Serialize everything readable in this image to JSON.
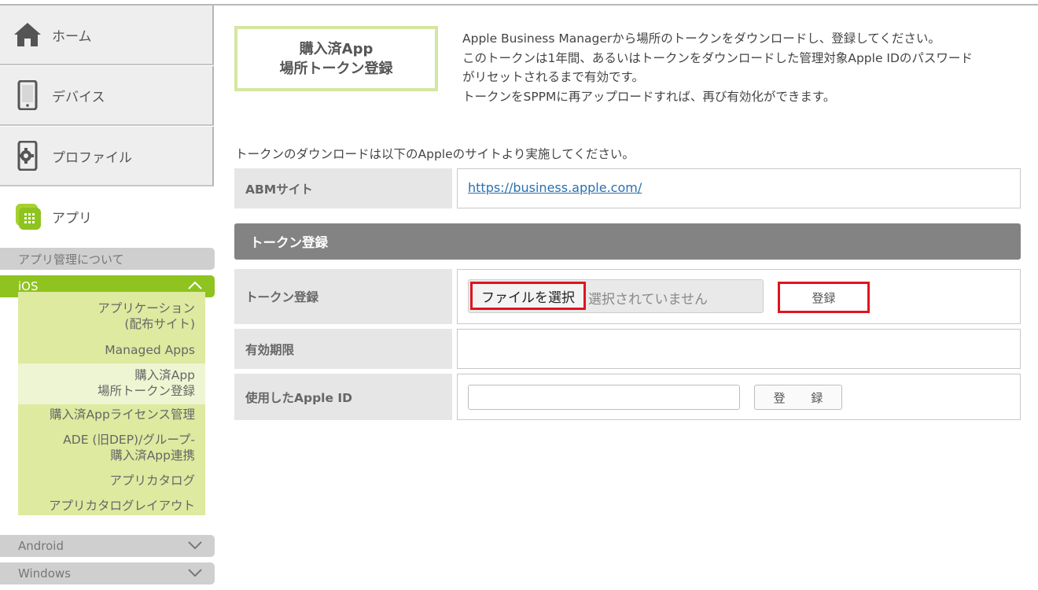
{
  "sidebar": {
    "home": "ホーム",
    "devices": "デバイス",
    "profiles": "プロファイル",
    "apps": "アプリ",
    "about_apps": "アプリ管理について",
    "ios": "iOS",
    "ios_items": [
      {
        "line1": "アプリケーション",
        "line2": "(配布サイト)"
      },
      {
        "line1": "Managed Apps",
        "line2": ""
      },
      {
        "line1": "購入済App",
        "line2": "場所トークン登録"
      },
      {
        "line1": "購入済Appライセンス管理",
        "line2": ""
      },
      {
        "line1": "ADE (旧DEP)/グループ-",
        "line2": "購入済App連携"
      },
      {
        "line1": "アプリカタログ",
        "line2": ""
      },
      {
        "line1": "アプリカタログレイアウト",
        "line2": ""
      }
    ],
    "android": "Android",
    "windows": "Windows"
  },
  "header": {
    "title_line1": "購入済App",
    "title_line2": "場所トークン登録",
    "desc_lines": [
      "Apple Business Managerから場所のトークンをダウンロードし、登録してください。",
      "このトークンは1年間、あるいはトークンをダウンロードした管理対象Apple IDのパスワード",
      "がリセットされるまで有効です。",
      "トークンをSPPMに再アップロードすれば、再び有効化ができます。"
    ]
  },
  "download_note": "トークンのダウンロードは以下のAppleのサイトより実施してください。",
  "abm": {
    "label": "ABMサイト",
    "url": "https://business.apple.com/"
  },
  "token_section": {
    "heading": "トークン登録",
    "token_label": "トークン登録",
    "file_button": "ファイルを選択",
    "file_status": "選択されていません",
    "register_button": "登録",
    "expiry_label": "有効期限",
    "expiry_value": "",
    "apple_id_label": "使用したApple ID",
    "apple_id_value": "",
    "apple_id_register": "登 録"
  },
  "colors": {
    "accent_green": "#8fc31f",
    "highlight_red": "#e0141e",
    "section_gray": "#838383"
  }
}
